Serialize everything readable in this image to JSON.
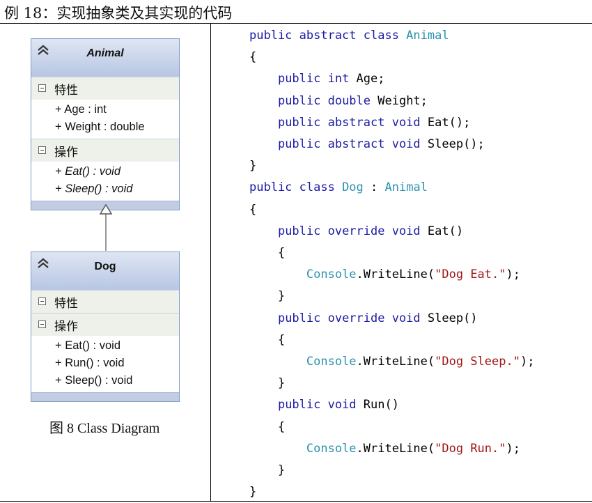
{
  "heading": "例 18：实现抽象类及其实现的代码",
  "diagram": {
    "animal": {
      "name": "Animal",
      "attributes_label": "特性",
      "attributes": [
        "+ Age : int",
        "+ Weight : double"
      ],
      "operations_label": "操作",
      "operations": [
        "+ Eat() : void",
        "+ Sleep() : void"
      ]
    },
    "dog": {
      "name": "Dog",
      "attributes_label": "特性",
      "operations_label": "操作",
      "operations": [
        "+ Eat() : void",
        "+ Run() : void",
        "+ Sleep() : void"
      ]
    },
    "caption": "图 8 Class Diagram"
  },
  "code": {
    "lines": [
      [
        [
          "kw",
          "public abstract class "
        ],
        [
          "ty",
          "Animal"
        ]
      ],
      [
        [
          "pl",
          "{"
        ]
      ],
      [
        [
          "pl",
          "    "
        ],
        [
          "kw",
          "public int "
        ],
        [
          "pl",
          "Age;"
        ]
      ],
      [
        [
          "pl",
          "    "
        ],
        [
          "kw",
          "public double "
        ],
        [
          "pl",
          "Weight;"
        ]
      ],
      [
        [
          "pl",
          "    "
        ],
        [
          "kw",
          "public abstract void "
        ],
        [
          "pl",
          "Eat();"
        ]
      ],
      [
        [
          "pl",
          "    "
        ],
        [
          "kw",
          "public abstract void "
        ],
        [
          "pl",
          "Sleep();"
        ]
      ],
      [
        [
          "pl",
          "}"
        ]
      ],
      [
        [
          "kw",
          "public class "
        ],
        [
          "ty",
          "Dog"
        ],
        [
          "pl",
          " : "
        ],
        [
          "ty",
          "Animal"
        ]
      ],
      [
        [
          "pl",
          "{"
        ]
      ],
      [
        [
          "pl",
          "    "
        ],
        [
          "kw",
          "public override void "
        ],
        [
          "pl",
          "Eat()"
        ]
      ],
      [
        [
          "pl",
          "    {"
        ]
      ],
      [
        [
          "pl",
          "        "
        ],
        [
          "ty",
          "Console"
        ],
        [
          "pl",
          ".WriteLine("
        ],
        [
          "st",
          "\"Dog Eat.\""
        ],
        [
          "pl",
          ");"
        ]
      ],
      [
        [
          "pl",
          "    }"
        ]
      ],
      [
        [
          "pl",
          "    "
        ],
        [
          "kw",
          "public override void "
        ],
        [
          "pl",
          "Sleep()"
        ]
      ],
      [
        [
          "pl",
          "    {"
        ]
      ],
      [
        [
          "pl",
          "        "
        ],
        [
          "ty",
          "Console"
        ],
        [
          "pl",
          ".WriteLine("
        ],
        [
          "st",
          "\"Dog Sleep.\""
        ],
        [
          "pl",
          ");"
        ]
      ],
      [
        [
          "pl",
          "    }"
        ]
      ],
      [
        [
          "pl",
          "    "
        ],
        [
          "kw",
          "public void "
        ],
        [
          "pl",
          "Run()"
        ]
      ],
      [
        [
          "pl",
          "    {"
        ]
      ],
      [
        [
          "pl",
          "        "
        ],
        [
          "ty",
          "Console"
        ],
        [
          "pl",
          ".WriteLine("
        ],
        [
          "st",
          "\"Dog Run.\""
        ],
        [
          "pl",
          ");"
        ]
      ],
      [
        [
          "pl",
          "    }"
        ]
      ],
      [
        [
          "pl",
          "}"
        ]
      ]
    ]
  }
}
